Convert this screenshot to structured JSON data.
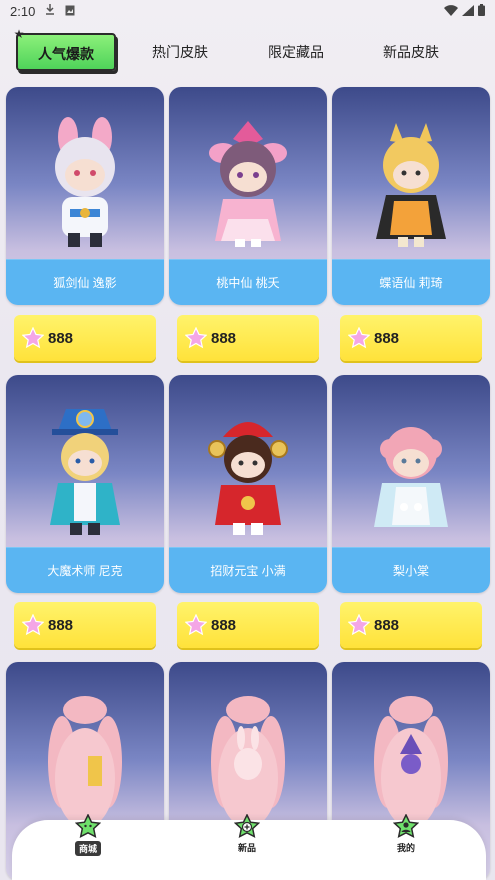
{
  "status_bar": {
    "time": "2:10"
  },
  "tabs": [
    {
      "label": "人气爆款",
      "active": true
    },
    {
      "label": "热门皮肤",
      "active": false
    },
    {
      "label": "限定藏品",
      "active": false
    },
    {
      "label": "新品皮肤",
      "active": false
    }
  ],
  "items": [
    {
      "name": "狐剑仙 逸影",
      "price": "888"
    },
    {
      "name": "桃中仙 桃夭",
      "price": "888"
    },
    {
      "name": "蝶语仙 莉琦",
      "price": "888"
    },
    {
      "name": "大魔术师 尼克",
      "price": "888"
    },
    {
      "name": "招财元宝 小满",
      "price": "888"
    },
    {
      "name": "梨小棠",
      "price": "888"
    },
    {
      "name": "",
      "price": ""
    },
    {
      "name": "",
      "price": ""
    },
    {
      "name": "",
      "price": ""
    }
  ],
  "bottom_nav": [
    {
      "label": "商城",
      "icon": "star-shop-icon",
      "active": true
    },
    {
      "label": "新品",
      "icon": "star-plus-icon",
      "active": false
    },
    {
      "label": "我的",
      "icon": "star-person-icon",
      "active": false
    }
  ],
  "colors": {
    "tab_active": "#4fd35a",
    "label_band": "#5ab5f2",
    "price_bg": "#ffe23a",
    "gem": "#f4a6e6"
  }
}
